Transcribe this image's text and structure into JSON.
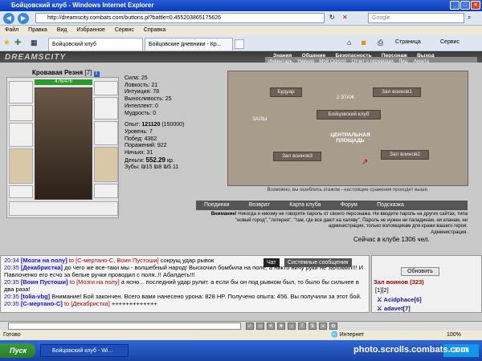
{
  "window": {
    "title": "Бойцовский клуб - Windows Internet Explorer"
  },
  "address": {
    "url": "http://dreamscity.combats.com/buttons.pl?battle=0.455203865175626",
    "search_placeholder": "Google"
  },
  "menu": {
    "items": [
      "Файл",
      "Правка",
      "Вид",
      "Избранное",
      "Сервис",
      "Справка"
    ]
  },
  "tabs": [
    {
      "label": "Бойцовский клуб"
    },
    {
      "label": "Бойцовские дневники - Кр..."
    }
  ],
  "ie_toolbar": {
    "page": "Страница",
    "tools": "Сервис"
  },
  "game": {
    "logo": "DREAMSCITY",
    "topnav": [
      "Знания",
      "Общение",
      "Безопасность",
      "Персонаж",
      "Выход"
    ],
    "subnav": [
      "Инвентарь",
      "Умения",
      "Мой Скролл",
      "Отчет о переводах",
      "Лиц.",
      "Анкета"
    ],
    "character": {
      "name": "Кровавая Резня",
      "level": "[7]",
      "hp": "476/476"
    },
    "stats": {
      "strength": "Сила: 25",
      "agility": "Ловкость: 21",
      "intuition": "Интуиция: 78",
      "endurance": "Выносливость: 25",
      "intellect": "Интеллект: 0",
      "wisdom": "Мудрость: 0",
      "exp_label": "Опыт:",
      "exp": "121120",
      "exp_next": "(150000)",
      "level": "Уровень: 7",
      "wins": "Побед: 4362",
      "losses": "Поражений: 922",
      "draws": "Ничьих: 31",
      "money_label": "Деньги:",
      "money": "552.29",
      "money_unit": "кр.",
      "teeth": "Зубы: ₪15 ₪8 ₪5.11"
    },
    "map": {
      "labels": [
        "Будуар",
        "Зал воинов1",
        "2 ЭТАЖ",
        "Бойцовский клуб",
        "ЗАЛЫ",
        "ЦЕНТРАЛЬНАЯ ПЛОЩАДЬ",
        "Зал воинов3",
        "Зал воинов2"
      ],
      "note": "Возможно, вы ошиблись этажом - настоящие сражения проходят выше."
    },
    "buttons": [
      "Поединки",
      "Возврат",
      "Карта клуба",
      "Форум",
      "Подсказка"
    ],
    "warning_bold": "Внимание!",
    "warning": "Никогда и никому не говорите пароль от своего персонажа. Не вводите пароль на других сайтах, типа \"новый город\", \"лотерея\", \"там, где все дают на халяву\". Пароль не нужен ни паладинам, ни кланам, ни администрации, только взломщикам для кражи вашего героя.",
    "admin": "Администрация.",
    "online": "Сейчас в клубе 1306 чел."
  },
  "chat": {
    "tabs": [
      "Чат",
      "Системные сообщения"
    ],
    "lines": [
      {
        "time": "20:34",
        "name": "[Мозги на полу]",
        "to": "to [С-мертано-С, Воин Пустоши]",
        "text": " сокрущ удар рывок"
      },
      {
        "time": "20:35",
        "name": "[Декабристка]",
        "to": "",
        "text": " до чего же все-таки мы - волшебный народ! Выскочил бомбила на поле, а никто ничу руки не заломил!!! И Павлоченко его есчо за белые ручки проводил с поля..!! Абалдеть!!!"
      },
      {
        "time": "20:35",
        "name": "[Воин Пустоши]",
        "to": "to [Мозги на полу]",
        "text": " а ясно... последний удар рулит. а если бы он под рывком был, то было бы сильнее в два раза!"
      },
      {
        "time": "20:35",
        "name": "[tolia-vbg]",
        "to": "",
        "text": " Внимание! Бой закончен. Всего вами нанесено урона: 828 HP. Получено опыта: 456. Вы получили за этот бой."
      },
      {
        "time": "20:35",
        "name": "[С-мертано-С]",
        "to": "to [Декабристка]",
        "text": " +++++++++++++"
      }
    ],
    "panel": {
      "refresh": "Обновить",
      "room": "Зал воинов (323)",
      "pages": "[1][2]",
      "users": [
        "Acidphace[6]",
        "adavet[7]"
      ]
    }
  },
  "statusbar": {
    "text": "Готово",
    "zone": "Интернет",
    "zoom": "100%"
  },
  "taskbar": {
    "start": "Пуск",
    "task": "Бойцовский клуб - Wi...",
    "time": "20:36"
  },
  "watermark": "photo.scrolls.combats.com"
}
